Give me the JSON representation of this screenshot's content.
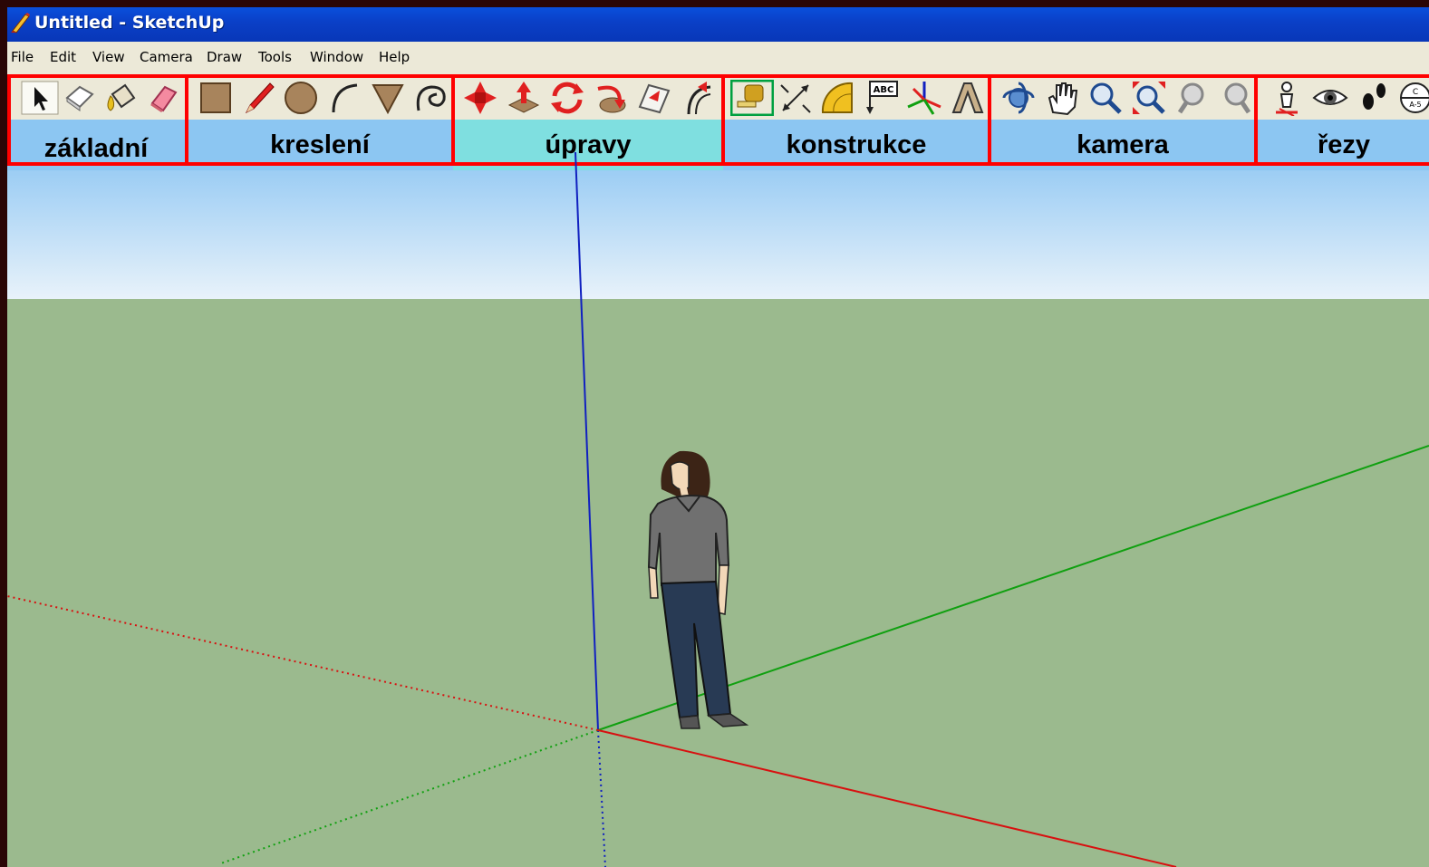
{
  "window": {
    "title": "Untitled - SketchUp"
  },
  "menu": [
    "File",
    "Edit",
    "View",
    "Camera",
    "Draw",
    "Tools",
    "Window",
    "Help"
  ],
  "sections": [
    {
      "label": "základní"
    },
    {
      "label": "kreslení"
    },
    {
      "label": "úpravy"
    },
    {
      "label": "konstrukce"
    },
    {
      "label": "kamera"
    },
    {
      "label": "řezy"
    }
  ],
  "tools": {
    "zakladni": [
      "select-icon",
      "component-icon",
      "paint-bucket-icon",
      "eraser-icon"
    ],
    "kresleni": [
      "rectangle-icon",
      "pencil-icon",
      "circle-icon",
      "arc-icon",
      "polygon-icon",
      "freehand-icon"
    ],
    "upravy": [
      "move-icon",
      "push-pull-icon",
      "rotate-icon",
      "follow-me-icon",
      "scale-icon",
      "offset-icon"
    ],
    "konstrukce": [
      "tape-measure-icon",
      "dimension-icon",
      "protractor-icon",
      "text-icon",
      "axes-icon",
      "3d-text-icon"
    ],
    "kamera": [
      "orbit-icon",
      "pan-icon",
      "zoom-icon",
      "zoom-extents-icon",
      "previous-view-icon",
      "next-view-icon"
    ],
    "rezy": [
      "position-camera-icon",
      "look-around-icon",
      "walk-icon",
      "section-plane-icon"
    ]
  },
  "colors": {
    "highlight_box": "#ff0000",
    "active_tool_box": "#00a040",
    "label_strip": "#8cc6f2",
    "active_label": "#7fdfe0",
    "ground": "#9bba8e",
    "red_axis": "#d81010",
    "green_axis": "#10b010",
    "blue_axis": "#1020c0"
  }
}
